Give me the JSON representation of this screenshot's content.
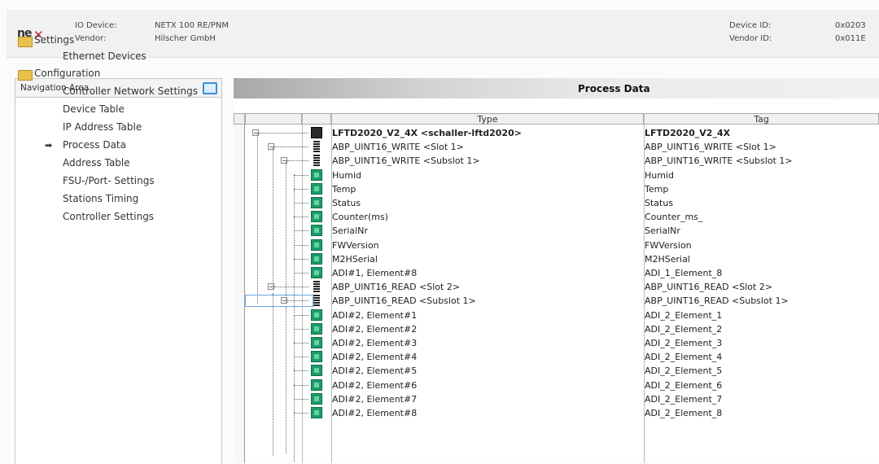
{
  "header": {
    "logo_text": "netx",
    "io_device_label": "IO Device:",
    "io_device_value": "NETX 100 RE/PNM",
    "vendor_label": "Vendor:",
    "vendor_value": "Hilscher GmbH",
    "device_id_label": "Device ID:",
    "device_id_value": "0x0203",
    "vendor_id_label": "Vendor ID:",
    "vendor_id_value": "0x011E"
  },
  "navigation": {
    "title": "Navigation Area",
    "items": [
      {
        "label": "Settings",
        "type": "folder"
      },
      {
        "label": "Ethernet Devices",
        "type": "item"
      },
      {
        "label": "Configuration",
        "type": "folder"
      },
      {
        "label": "Controller Network Settings",
        "type": "item"
      },
      {
        "label": "Device Table",
        "type": "item"
      },
      {
        "label": "IP Address Table",
        "type": "item"
      },
      {
        "label": "Process Data",
        "type": "item",
        "active": true
      },
      {
        "label": "Address Table",
        "type": "item"
      },
      {
        "label": "FSU-/Port- Settings",
        "type": "item"
      },
      {
        "label": "Stations Timing",
        "type": "item"
      },
      {
        "label": "Controller Settings",
        "type": "item"
      }
    ]
  },
  "process_data": {
    "title": "Process Data",
    "columns": [
      "Type",
      "Tag"
    ],
    "rows": [
      {
        "type": "LFTD2020_V2_4X <schaller-lftd2020>",
        "tag": "LFTD2020_V2_4X",
        "icon": "device",
        "level": 0,
        "bold": true
      },
      {
        "type": "ABP_UINT16_WRITE <Slot 1>",
        "tag": "ABP_UINT16_WRITE <Slot 1>",
        "icon": "slot",
        "level": 1
      },
      {
        "type": "ABP_UINT16_WRITE <Subslot 1>",
        "tag": "ABP_UINT16_WRITE <Subslot 1>",
        "icon": "slot",
        "level": 2
      },
      {
        "type": "Humid",
        "tag": "Humid",
        "icon": "adi",
        "level": 3
      },
      {
        "type": "Temp",
        "tag": "Temp",
        "icon": "adi",
        "level": 3
      },
      {
        "type": "Status",
        "tag": "Status",
        "icon": "adi",
        "level": 3
      },
      {
        "type": "Counter(ms)",
        "tag": "Counter_ms_",
        "icon": "adi",
        "level": 3
      },
      {
        "type": "SerialNr",
        "tag": "SerialNr",
        "icon": "adi",
        "level": 3
      },
      {
        "type": "FWVersion",
        "tag": "FWVersion",
        "icon": "adi",
        "level": 3
      },
      {
        "type": "M2HSerial",
        "tag": "M2HSerial",
        "icon": "adi",
        "level": 3
      },
      {
        "type": "ADI#1, Element#8",
        "tag": "ADI_1_Element_8",
        "icon": "adi",
        "level": 3
      },
      {
        "type": "ABP_UINT16_READ <Slot 2>",
        "tag": "ABP_UINT16_READ <Slot 2>",
        "icon": "slot",
        "level": 1
      },
      {
        "type": "ABP_UINT16_READ <Subslot 1>",
        "tag": "ABP_UINT16_READ <Subslot 1>",
        "icon": "slot",
        "level": 2,
        "selected": true
      },
      {
        "type": "ADI#2, Element#1",
        "tag": "ADI_2_Element_1",
        "icon": "adi",
        "level": 3
      },
      {
        "type": "ADI#2, Element#2",
        "tag": "ADI_2_Element_2",
        "icon": "adi",
        "level": 3
      },
      {
        "type": "ADI#2, Element#3",
        "tag": "ADI_2_Element_3",
        "icon": "adi",
        "level": 3
      },
      {
        "type": "ADI#2, Element#4",
        "tag": "ADI_2_Element_4",
        "icon": "adi",
        "level": 3
      },
      {
        "type": "ADI#2, Element#5",
        "tag": "ADI_2_Element_5",
        "icon": "adi",
        "level": 3
      },
      {
        "type": "ADI#2, Element#6",
        "tag": "ADI_2_Element_6",
        "icon": "adi",
        "level": 3
      },
      {
        "type": "ADI#2, Element#7",
        "tag": "ADI_2_Element_7",
        "icon": "adi",
        "level": 3
      },
      {
        "type": "ADI#2, Element#8",
        "tag": "ADI_2_Element_8",
        "icon": "adi",
        "level": 3
      }
    ]
  }
}
